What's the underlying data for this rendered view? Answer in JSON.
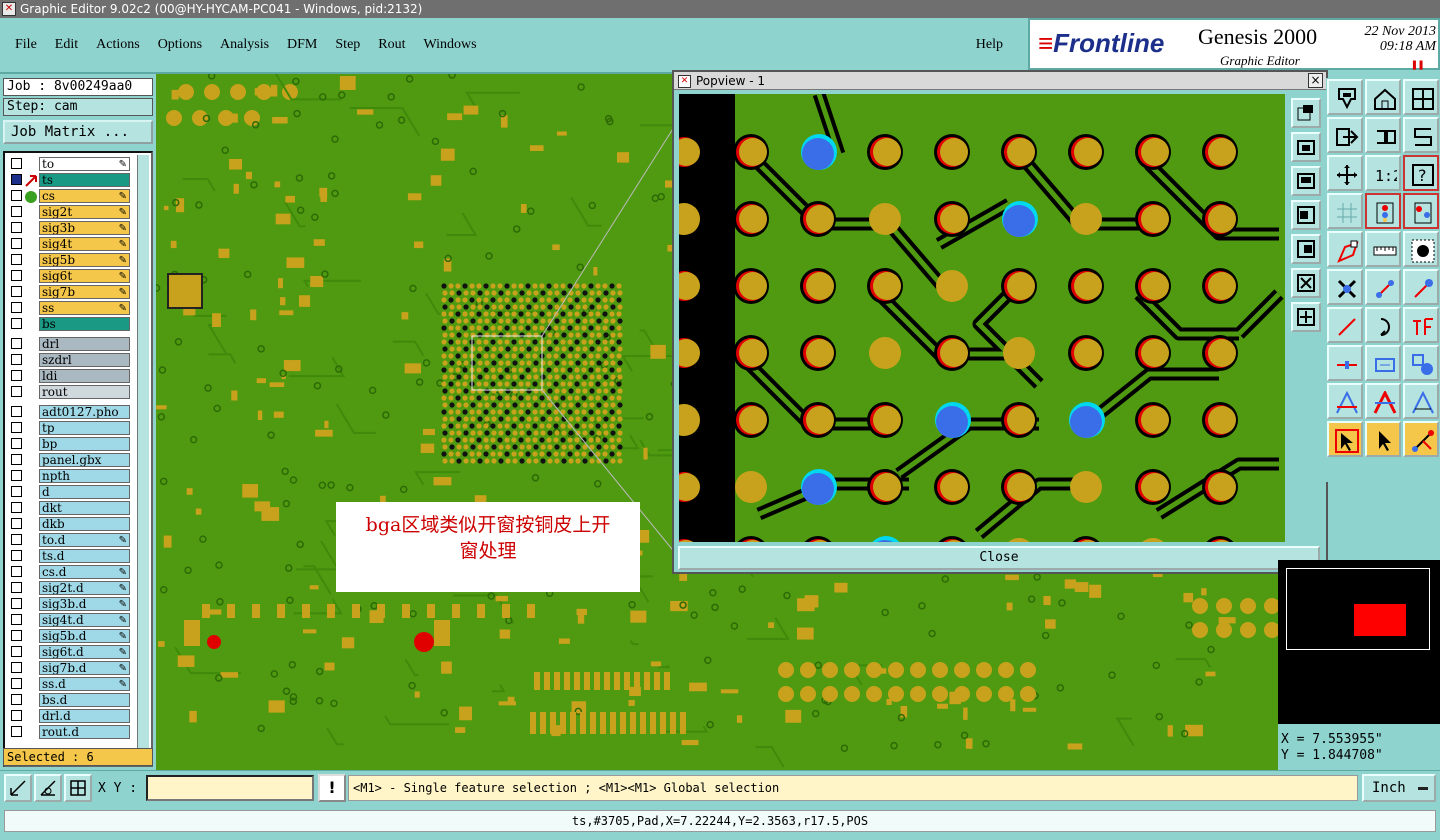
{
  "window": {
    "title": "Graphic Editor 9.02c2 (00@HY-HYCAM-PC041 - Windows, pid:2132)"
  },
  "menu": [
    "File",
    "Edit",
    "Actions",
    "Options",
    "Analysis",
    "DFM",
    "Step",
    "Rout",
    "Windows"
  ],
  "help_label": "Help",
  "logo": {
    "brand": "Frontline",
    "product": "Genesis 2000",
    "date": "22 Nov 2013",
    "time": "09:18 AM",
    "subtitle": "Graphic Editor"
  },
  "job": {
    "job_label": "Job : 8v00249aa0",
    "step_label": "Step: cam",
    "matrix_button": "Job Matrix ..."
  },
  "layers": [
    {
      "name": "to",
      "color": "#ffffff",
      "pen": true
    },
    {
      "name": "ts",
      "color": "#1a9a84",
      "pen": false,
      "active": true
    },
    {
      "name": "cs",
      "color": "#f4c64a",
      "pen": true
    },
    {
      "name": "sig2t",
      "color": "#f4c64a",
      "pen": true
    },
    {
      "name": "sig3b",
      "color": "#f4c64a",
      "pen": true
    },
    {
      "name": "sig4t",
      "color": "#f4c64a",
      "pen": true
    },
    {
      "name": "sig5b",
      "color": "#f4c64a",
      "pen": true
    },
    {
      "name": "sig6t",
      "color": "#f4c64a",
      "pen": true
    },
    {
      "name": "sig7b",
      "color": "#f4c64a",
      "pen": true
    },
    {
      "name": "ss",
      "color": "#f4c64a",
      "pen": true
    },
    {
      "name": "bs",
      "color": "#1a9a84",
      "pen": false
    },
    {
      "name": "drl",
      "color": "#a9b8c1",
      "pen": false,
      "gap": true
    },
    {
      "name": "szdrl",
      "color": "#a9b8c1",
      "pen": false
    },
    {
      "name": "ldi",
      "color": "#a9b8c1",
      "pen": false
    },
    {
      "name": "rout",
      "color": "#cfd8dc",
      "pen": false
    },
    {
      "name": "adt0127.pho",
      "color": "#9fd8e6",
      "pen": false,
      "gap": true
    },
    {
      "name": "tp",
      "color": "#9fd8e6",
      "pen": false
    },
    {
      "name": "bp",
      "color": "#9fd8e6",
      "pen": false
    },
    {
      "name": "panel.gbx",
      "color": "#9fd8e6",
      "pen": false
    },
    {
      "name": "npth",
      "color": "#9fd8e6",
      "pen": false
    },
    {
      "name": "d",
      "color": "#9fd8e6",
      "pen": false
    },
    {
      "name": "dkt",
      "color": "#9fd8e6",
      "pen": false
    },
    {
      "name": "dkb",
      "color": "#9fd8e6",
      "pen": false
    },
    {
      "name": "to.d",
      "color": "#9fd8e6",
      "pen": true
    },
    {
      "name": "ts.d",
      "color": "#9fd8e6",
      "pen": false
    },
    {
      "name": "cs.d",
      "color": "#9fd8e6",
      "pen": true
    },
    {
      "name": "sig2t.d",
      "color": "#9fd8e6",
      "pen": true
    },
    {
      "name": "sig3b.d",
      "color": "#9fd8e6",
      "pen": true
    },
    {
      "name": "sig4t.d",
      "color": "#9fd8e6",
      "pen": true
    },
    {
      "name": "sig5b.d",
      "color": "#9fd8e6",
      "pen": true
    },
    {
      "name": "sig6t.d",
      "color": "#9fd8e6",
      "pen": true
    },
    {
      "name": "sig7b.d",
      "color": "#9fd8e6",
      "pen": true
    },
    {
      "name": "ss.d",
      "color": "#9fd8e6",
      "pen": true
    },
    {
      "name": "bs.d",
      "color": "#9fd8e6",
      "pen": false
    },
    {
      "name": "drl.d",
      "color": "#9fd8e6",
      "pen": false
    },
    {
      "name": "rout.d",
      "color": "#9fd8e6",
      "pen": false
    }
  ],
  "selected": "Selected : 6",
  "annotation": {
    "line1": "bga区域类似开窗按铜皮上开",
    "line2": "窗处理"
  },
  "popview": {
    "title": "Popview - 1",
    "close_label": "Close"
  },
  "coords": {
    "x": "X = 7.553955\"",
    "y": "Y = 1.844708\""
  },
  "bottom": {
    "xy_label": "X Y :",
    "xy_value": "",
    "exclaim": "!",
    "hint": "<M1> - Single feature selection ; <M1><M1> Global selection",
    "units": "Inch"
  },
  "status": "ts,#3705,Pad,X=7.22244,Y=2.3563,r17.5,POS",
  "colors": {
    "board_green": "#4f9a10",
    "copper": "#c8a21c",
    "mask_red": "#e00000",
    "via_blue": "#3a6ee8",
    "panel_teal": "#8fd3cf"
  }
}
